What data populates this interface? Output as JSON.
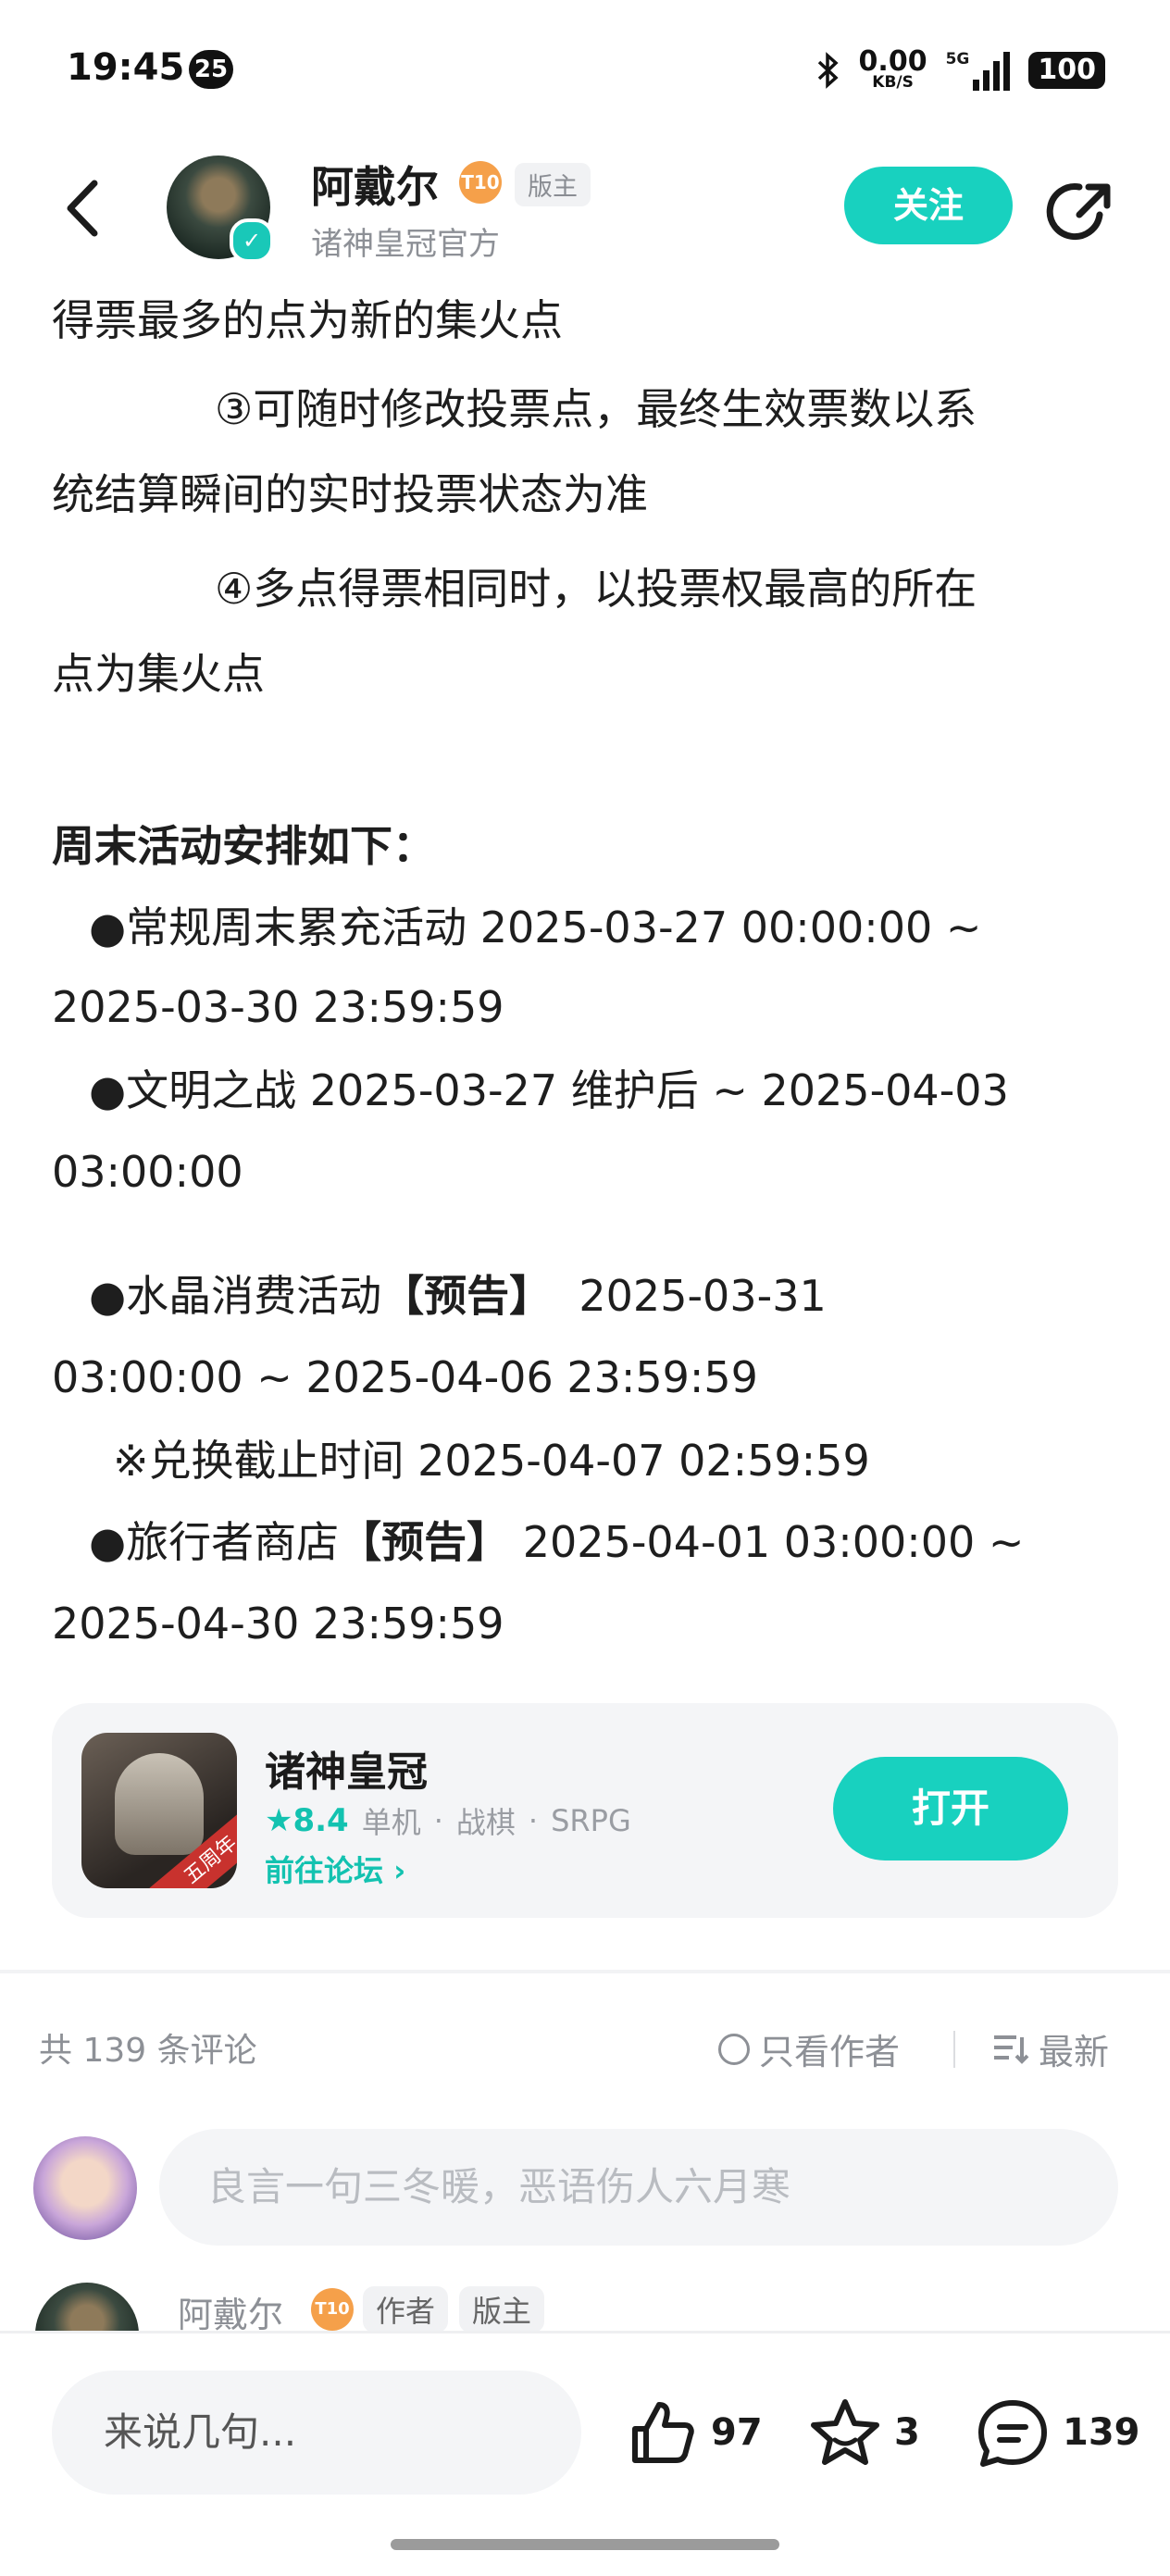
{
  "status_bar": {
    "time": "19:45",
    "notification_count": "25",
    "net_speed": "0.00",
    "net_unit": "KB/S",
    "signal": "5G",
    "battery": "100"
  },
  "header": {
    "author_name": "阿戴尔",
    "level": "T10",
    "role_tag": "版主",
    "subtitle": "诸神皇冠官方",
    "follow_label": "关注"
  },
  "article": {
    "lines": [
      "得票最多的点为新的集火点",
      "③可随时修改投票点，最终生效票数以系",
      "统结算瞬间的实时投票状态为准",
      "④多点得票相同时，以投票权最高的所在",
      "点为集火点",
      "周末活动安排如下：",
      "●常规周末累充活动 2025-03-27 00:00:00 ~",
      "2025-03-30 23:59:59",
      "●文明之战 2025-03-27 维护后 ~ 2025-04-03",
      "03:00:00",
      "●水晶消费活动",
      "【预告】",
      "2025-03-31",
      "03:00:00 ~ 2025-04-06 23:59:59",
      "※兑换截止时间 2025-04-07 02:59:59",
      "●旅行者商店",
      "【预告】",
      "2025-04-01 03:00:00 ~",
      "2025-04-30 23:59:59"
    ]
  },
  "app_card": {
    "name": "诸神皇冠",
    "rating": "8.4",
    "tags": [
      "单机",
      "战棋",
      "SRPG"
    ],
    "forum_link": "前往论坛",
    "open_label": "打开",
    "icon_ribbon": "五周年"
  },
  "comments": {
    "count_text": "共 139 条评论",
    "only_author": "只看作者",
    "sort": "最新",
    "input_placeholder": "良言一句三冬暖，恶语伤人六月寒",
    "first_reply": {
      "name": "阿戴尔",
      "level": "T10",
      "tag_author": "作者",
      "tag_mod": "版主"
    }
  },
  "bottom_bar": {
    "input_placeholder": "来说几句...",
    "likes": "97",
    "favorites": "3",
    "comments": "139"
  }
}
